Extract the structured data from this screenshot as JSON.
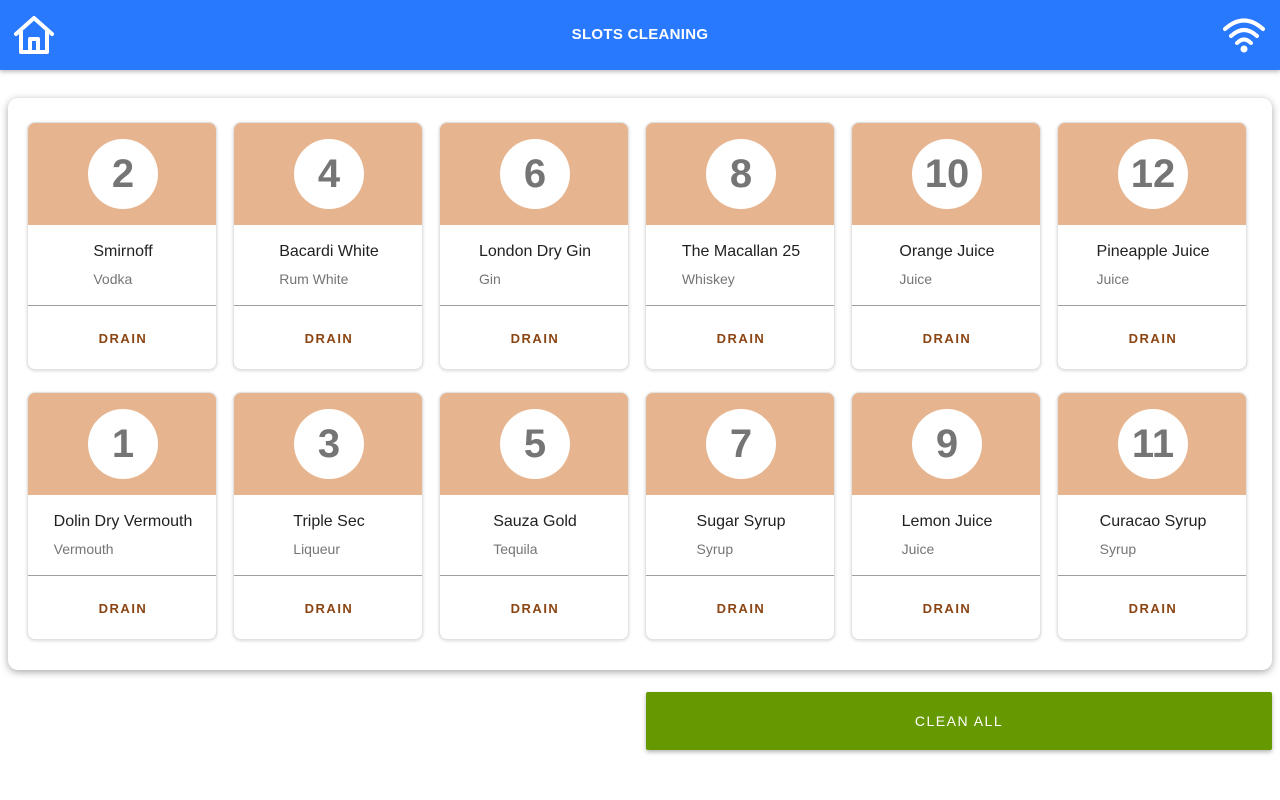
{
  "header": {
    "title": "SLOTS CLEANING",
    "home_icon": "home-icon",
    "wifi_icon": "wifi-icon",
    "bar_color": "#2979ff"
  },
  "colors": {
    "card_header": "#e6b590",
    "drain_text": "#8b4513",
    "clean_all_bg": "#669900"
  },
  "slots": [
    {
      "number": "2",
      "name": "Smirnoff",
      "type": "Vodka",
      "action": "DRAIN"
    },
    {
      "number": "4",
      "name": "Bacardi White",
      "type": "Rum White",
      "action": "DRAIN"
    },
    {
      "number": "6",
      "name": "London Dry Gin",
      "type": "Gin",
      "action": "DRAIN"
    },
    {
      "number": "8",
      "name": "The Macallan 25",
      "type": "Whiskey",
      "action": "DRAIN"
    },
    {
      "number": "10",
      "name": "Orange Juice",
      "type": "Juice",
      "action": "DRAIN"
    },
    {
      "number": "12",
      "name": "Pineapple Juice",
      "type": "Juice",
      "action": "DRAIN"
    },
    {
      "number": "1",
      "name": "Dolin Dry Vermouth",
      "type": "Vermouth",
      "action": "DRAIN"
    },
    {
      "number": "3",
      "name": "Triple Sec",
      "type": "Liqueur",
      "action": "DRAIN"
    },
    {
      "number": "5",
      "name": "Sauza Gold",
      "type": "Tequila",
      "action": "DRAIN"
    },
    {
      "number": "7",
      "name": "Sugar Syrup",
      "type": "Syrup",
      "action": "DRAIN"
    },
    {
      "number": "9",
      "name": "Lemon Juice",
      "type": "Juice",
      "action": "DRAIN"
    },
    {
      "number": "11",
      "name": "Curacao Syrup",
      "type": "Syrup",
      "action": "DRAIN"
    }
  ],
  "footer": {
    "clean_all_label": "CLEAN ALL"
  }
}
